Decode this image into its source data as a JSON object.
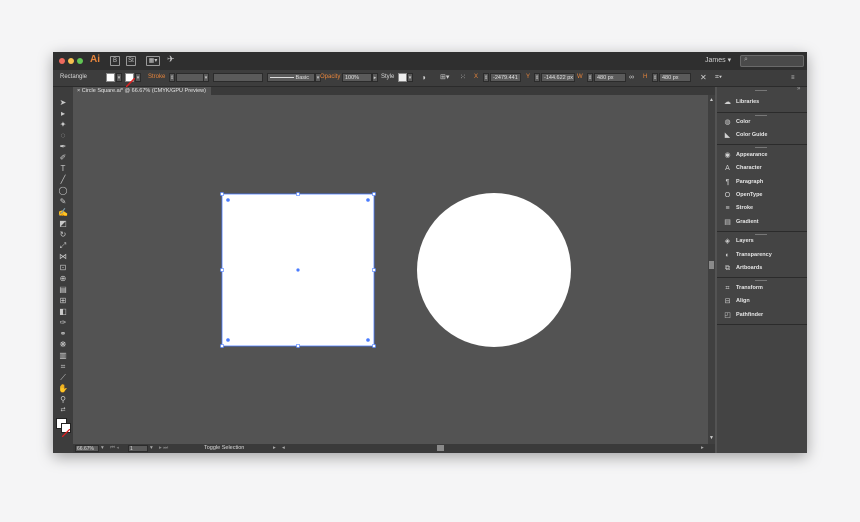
{
  "app": {
    "logo": "Ai",
    "user": "James",
    "search_placeholder": "⌕"
  },
  "control_bar": {
    "selection_label": "Rectangle",
    "stroke_label": "Stroke",
    "brush_label": "Basic",
    "opacity_label": "Opacity",
    "opacity_value": "100%",
    "style_label": "Style",
    "x_label": "X",
    "x_value": "-2479.441",
    "y_label": "Y",
    "y_value": "-144.622 px",
    "w_label": "W",
    "w_value": "480 px",
    "h_label": "H",
    "h_value": "480 px",
    "fill_color": "#ffffff",
    "accent": "#e8853b"
  },
  "document": {
    "tab_title": "Circle Square.ai* @ 66.67% (CMYK/GPU Preview)"
  },
  "status_bar": {
    "zoom": "66.67%",
    "artboard": "1",
    "info": "Toggle Selection"
  },
  "canvas": {
    "background": "#535353",
    "selection_color": "#4a7cff",
    "square_fill": "#ffffff",
    "circle_fill": "#ffffff"
  },
  "panels": {
    "group1": [
      {
        "icon": "libraries-icon",
        "label": "Libraries"
      }
    ],
    "group2": [
      {
        "icon": "color-icon",
        "label": "Color"
      },
      {
        "icon": "color-guide-icon",
        "label": "Color Guide"
      }
    ],
    "group3": [
      {
        "icon": "appearance-icon",
        "label": "Appearance"
      },
      {
        "icon": "character-icon",
        "label": "Character"
      },
      {
        "icon": "paragraph-icon",
        "label": "Paragraph"
      },
      {
        "icon": "opentype-icon",
        "label": "OpenType"
      },
      {
        "icon": "stroke-icon",
        "label": "Stroke"
      },
      {
        "icon": "gradient-icon",
        "label": "Gradient"
      }
    ],
    "group4": [
      {
        "icon": "layers-icon",
        "label": "Layers"
      },
      {
        "icon": "transparency-icon",
        "label": "Transparency"
      },
      {
        "icon": "artboards-icon",
        "label": "Artboards"
      }
    ],
    "group5": [
      {
        "icon": "transform-icon",
        "label": "Transform"
      },
      {
        "icon": "align-icon",
        "label": "Align"
      },
      {
        "icon": "pathfinder-icon",
        "label": "Pathfinder"
      }
    ]
  }
}
